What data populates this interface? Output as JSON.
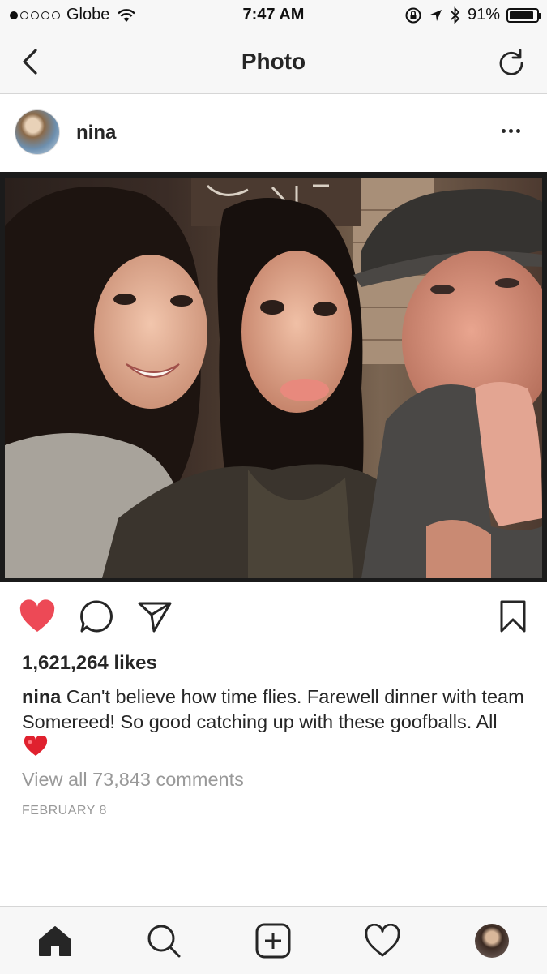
{
  "status_bar": {
    "carrier": "Globe",
    "time": "7:47 AM",
    "battery_percent": "91%",
    "signal_bars": 1
  },
  "nav": {
    "title": "Photo",
    "back_icon": "chevron-left-icon",
    "refresh_icon": "refresh-icon"
  },
  "post": {
    "username": "nina",
    "likes": "1,621,264 likes",
    "caption_user": "nina",
    "caption_text": " Can't believe how time flies. Farewell dinner with team Somereed! So good catching up with these goofballs. All",
    "view_comments": "View all 73,843 comments",
    "date": "FEBRUARY 8",
    "liked": true
  },
  "colors": {
    "like_red": "#ED4956",
    "text": "#262626",
    "muted": "#999999",
    "bar_bg": "#F7F7F7"
  },
  "tabs": [
    "home-icon",
    "search-icon",
    "add-icon",
    "activity-heart-icon",
    "profile-avatar"
  ]
}
